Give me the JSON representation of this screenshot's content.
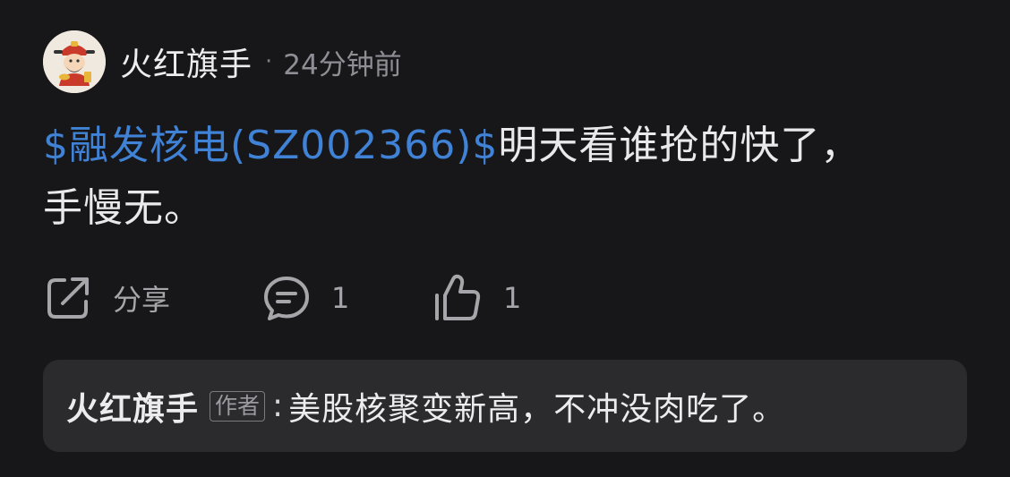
{
  "post": {
    "author": "火红旗手",
    "separator": "·",
    "time": "24分钟前",
    "stock_link": "$融发核电(SZ002366)$",
    "text_line1": "明天看谁抢的快了，",
    "text_line2": "手慢无。"
  },
  "actions": {
    "share_label": "分享",
    "comment_count": "1",
    "like_count": "1",
    "icons": [
      "share-icon",
      "comment-icon",
      "thumbs-up-icon"
    ]
  },
  "reply": {
    "author": "火红旗手",
    "badge": "作者",
    "colon": ":",
    "text": "美股核聚变新高，不冲没肉吃了。"
  },
  "colors": {
    "background": "#17171a",
    "link": "#3f82d6",
    "reply_bg": "#2b2b2e"
  }
}
